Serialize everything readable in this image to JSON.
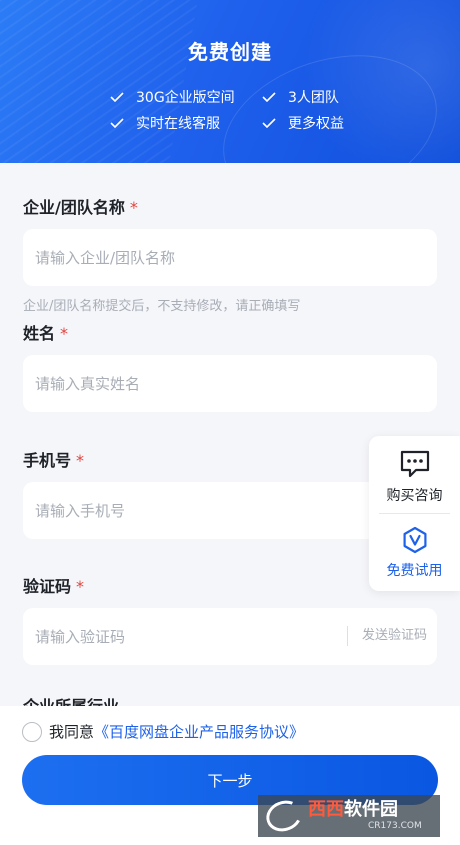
{
  "header": {
    "title": "免费创建",
    "benefits": [
      "30G企业版空间",
      "3人团队",
      "实时在线客服",
      "更多权益"
    ]
  },
  "form": {
    "company": {
      "label": "企业/团队名称",
      "required_mark": "*",
      "placeholder": "请输入企业/团队名称",
      "hint": "企业/团队名称提交后，不支持修改，请正确填写"
    },
    "name": {
      "label": "姓名",
      "required_mark": "*",
      "placeholder": "请输入真实姓名"
    },
    "phone": {
      "label": "手机号",
      "required_mark": "*",
      "placeholder": "请输入手机号"
    },
    "code": {
      "label": "验证码",
      "required_mark": "*",
      "placeholder": "请输入验证码",
      "send_button": "发送验证码"
    },
    "industry": {
      "label": "企业所属行业"
    }
  },
  "float_panel": {
    "consult_label": "购买咨询",
    "consult_icon": "chat-bubble-icon",
    "trial_label": "免费试用",
    "trial_icon": "v-badge-icon"
  },
  "footer": {
    "agree_prefix": "我同意",
    "agreement_link": "《百度网盘企业产品服务协议》",
    "next_button": "下一步"
  },
  "watermark": {
    "brand_left": "西西",
    "brand_right": "软件园",
    "domain": "CR173.COM"
  },
  "colors": {
    "accent": "#1e62e9",
    "required": "#e0443e",
    "header_gradient_start": "#2c7cf6",
    "header_gradient_end": "#0f4fdc"
  }
}
